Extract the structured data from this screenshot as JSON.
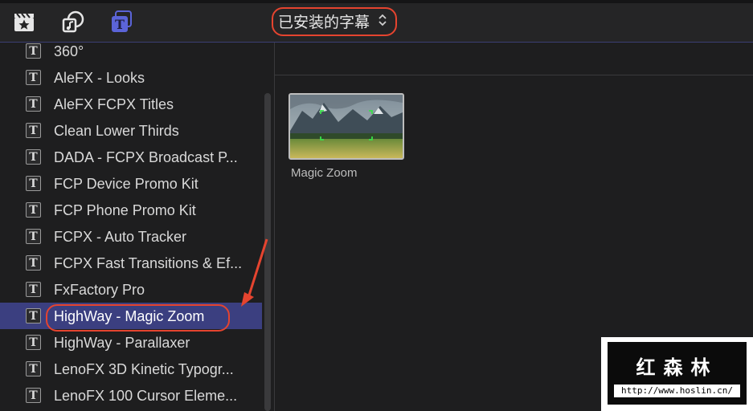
{
  "toolbar": {
    "icons": [
      "clapper-star-icon",
      "music-photo-icon",
      "titles-icon"
    ],
    "dropdown_label": "已安装的字幕",
    "accent_color": "#5b64d8"
  },
  "sidebar": {
    "items": [
      {
        "label": "360°"
      },
      {
        "label": "AleFX - Looks"
      },
      {
        "label": "AleFX FCPX Titles"
      },
      {
        "label": "Clean Lower Thirds"
      },
      {
        "label": "DADA - FCPX Broadcast P..."
      },
      {
        "label": "FCP Device Promo Kit"
      },
      {
        "label": "FCP Phone Promo Kit"
      },
      {
        "label": "FCPX - Auto Tracker"
      },
      {
        "label": "FCPX Fast Transitions & Ef..."
      },
      {
        "label": "FxFactory Pro"
      },
      {
        "label": "HighWay - Magic Zoom",
        "selected": true
      },
      {
        "label": "HighWay - Parallaxer"
      },
      {
        "label": "LenoFX 3D Kinetic Typogr..."
      },
      {
        "label": "LenoFX 100 Cursor Eleme..."
      }
    ],
    "selected_color": "#3b3f80"
  },
  "browser": {
    "clips": [
      {
        "label": "Magic Zoom"
      }
    ]
  },
  "annotation": {
    "color": "#e5442f"
  },
  "watermark": {
    "title": "红森林",
    "url": "http://www.hoslin.cn/"
  }
}
